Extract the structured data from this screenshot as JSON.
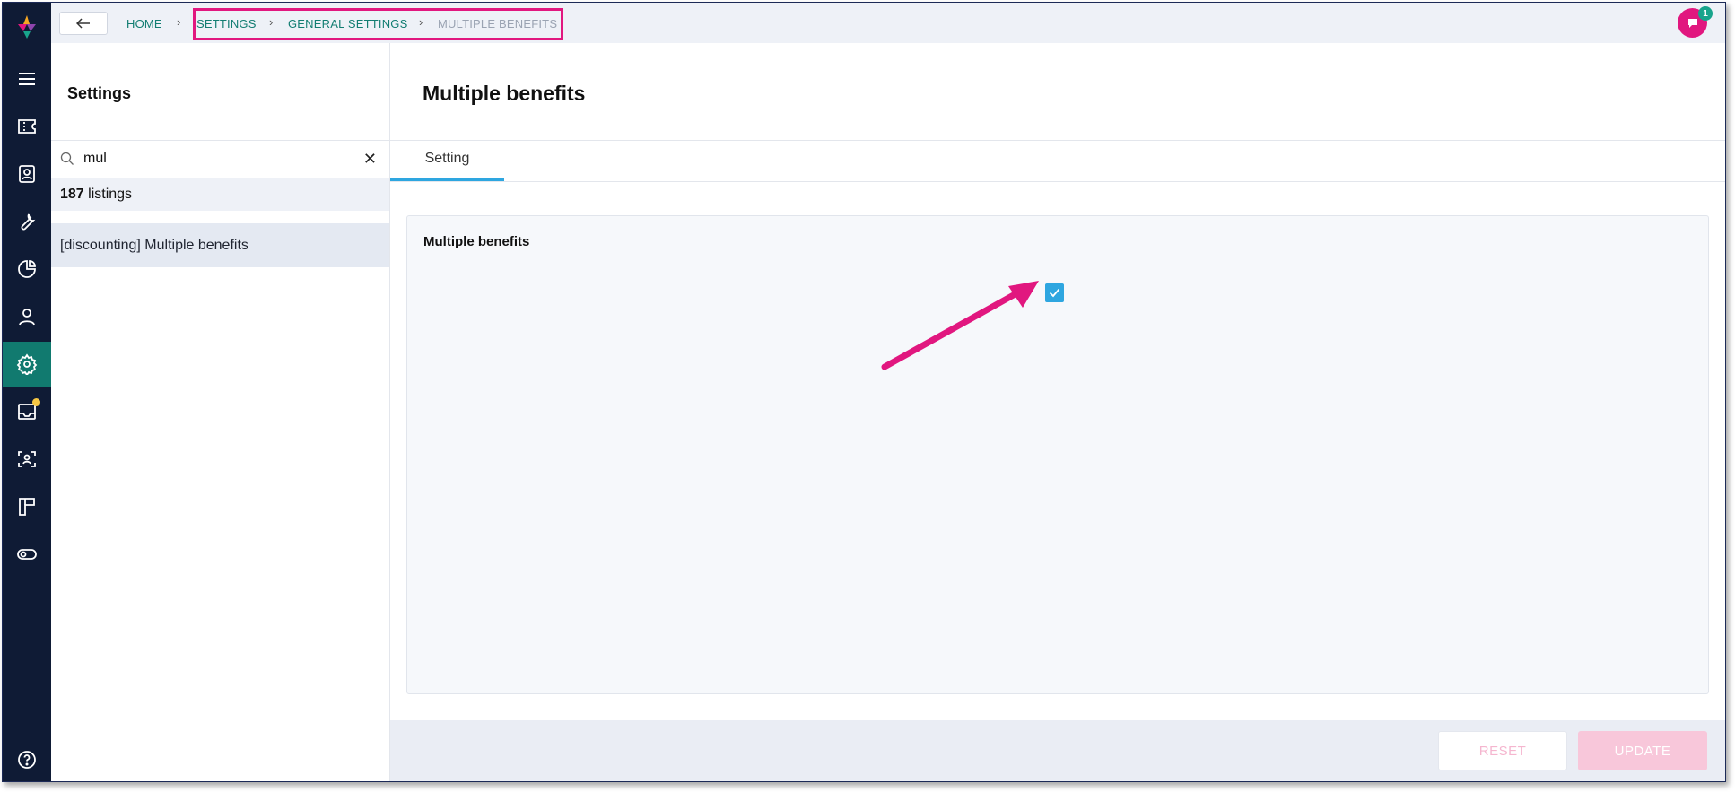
{
  "breadcrumb": {
    "items": [
      "HOME",
      "SETTINGS",
      "GENERAL SETTINGS",
      "MULTIPLE BENEFITS"
    ]
  },
  "notifications": {
    "count": "1"
  },
  "sidebar": {
    "title": "Settings",
    "search": {
      "value": "mul",
      "placeholder": ""
    },
    "result_count": "187",
    "result_label": " listings",
    "items": [
      {
        "label": "[discounting] Multiple benefits"
      }
    ]
  },
  "main": {
    "title": "Multiple benefits",
    "tabs": [
      {
        "label": "Setting"
      }
    ],
    "field": {
      "label": "Multiple benefits",
      "checked": true
    }
  },
  "footer": {
    "reset_label": "RESET",
    "update_label": "UPDATE"
  },
  "colors": {
    "rail": "#0f1b35",
    "rail_active": "#117a6f",
    "accent": "#e1177f",
    "link": "#127d72",
    "checkbox": "#2ea6e0"
  },
  "icons": {
    "rail": [
      "menu-icon",
      "ticket-icon",
      "contact-card-icon",
      "wrench-icon",
      "pie-chart-icon",
      "user-icon",
      "gear-icon",
      "inbox-icon",
      "face-scan-icon",
      "board-icon",
      "toggle-icon",
      "help-icon"
    ]
  }
}
